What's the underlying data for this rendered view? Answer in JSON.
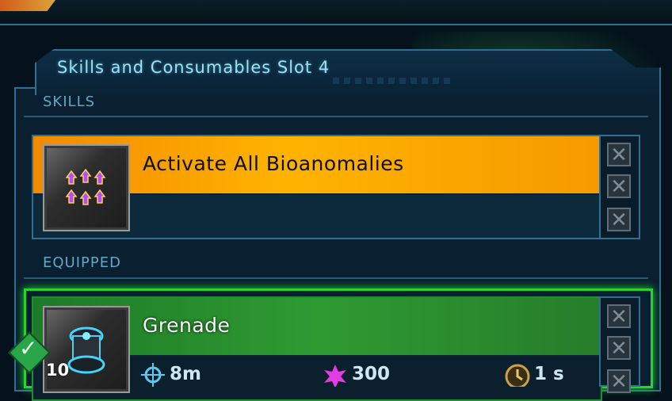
{
  "panel": {
    "title": "Skills and Consumables Slot 4"
  },
  "sections": {
    "skills_label": "SKILLS",
    "equipped_label": "EQUIPPED"
  },
  "skill_card": {
    "name": "Activate All Bioanomalies",
    "icon": "bioanomaly-icon",
    "accent": "#f7a300"
  },
  "equipped_card": {
    "name": "Grenade",
    "icon": "grenade-icon",
    "quantity": "10",
    "accent": "#2f9a32",
    "stats": [
      {
        "icon": "range-icon",
        "value": "8m"
      },
      {
        "icon": "damage-icon",
        "value": "300"
      },
      {
        "icon": "cooldown-icon",
        "value": "1 s"
      }
    ]
  }
}
